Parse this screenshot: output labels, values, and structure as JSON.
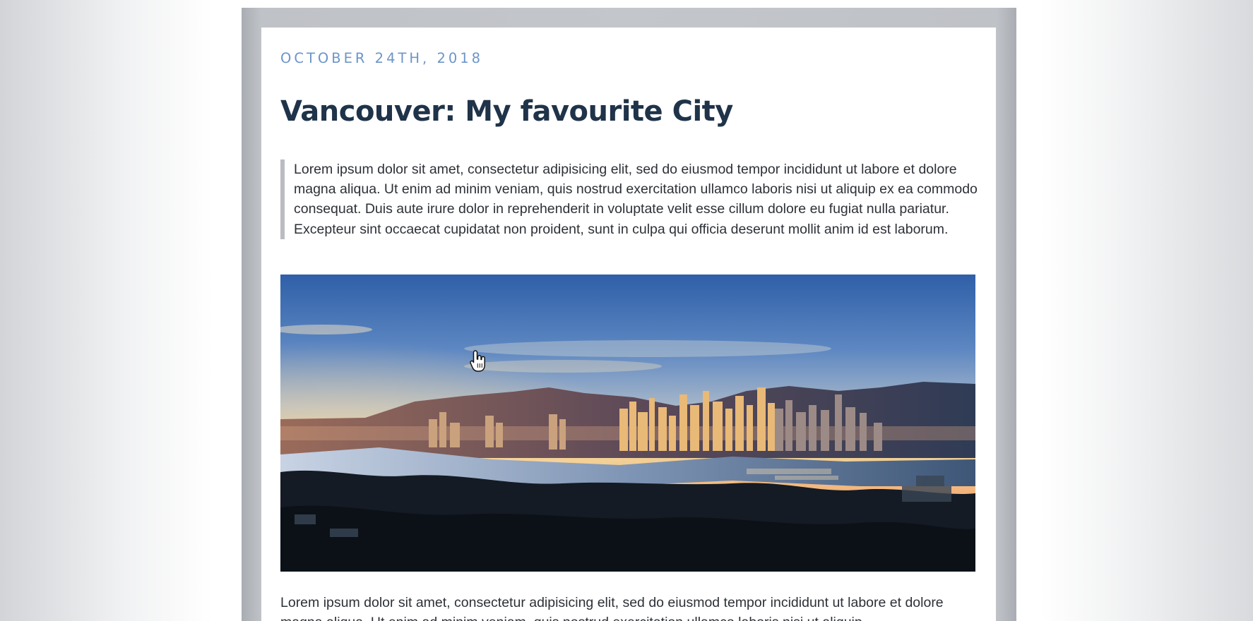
{
  "post": {
    "date": "OCTOBER 24TH, 2018",
    "title": "Vancouver: My favourite City",
    "quote": "Lorem ipsum dolor sit amet, consectetur adipisicing elit, sed do eiusmod tempor incididunt ut labore et dolore magna aliqua. Ut enim ad minim veniam, quis nostrud exercitation ullamco laboris nisi ut aliquip ex ea commodo consequat. Duis aute irure dolor in reprehenderit in voluptate velit esse cillum dolore eu fugiat nulla pariatur. Excepteur sint occaecat cupidatat non proident, sunt in culpa qui officia deserunt mollit anim id est laborum.",
    "image": {
      "subject": "Vancouver skyline panorama at sunset"
    },
    "body": "Lorem ipsum dolor sit amet, consectetur adipisicing elit, sed do eiusmod tempor incididunt ut labore et dolore magna aliqua. Ut enim ad minim veniam, quis nostrud exercitation ullamco laboris nisi ut aliquip"
  },
  "cursor": {
    "icon": "hand-pointer-icon"
  },
  "colors": {
    "date": "#6c95c9",
    "title": "#1f3349",
    "text": "#2d3137",
    "quote_border": "#b9bcc1",
    "frame": "#c3c6cb"
  }
}
